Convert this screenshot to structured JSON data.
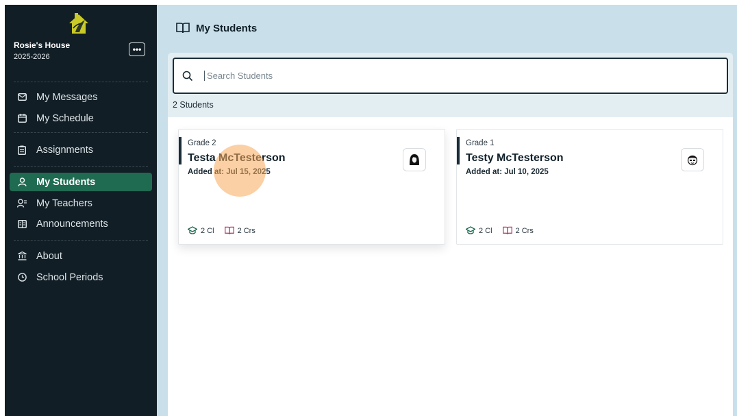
{
  "sidebar": {
    "house_name": "Rosie's House",
    "year": "2025-2026",
    "menu_label": "•••",
    "items": [
      {
        "label": "My Messages",
        "icon": "mail-icon"
      },
      {
        "label": "My Schedule",
        "icon": "calendar-icon"
      },
      {
        "label": "Assignments",
        "icon": "clipboard-icon"
      },
      {
        "label": "My Students",
        "icon": "user-icon",
        "active": true
      },
      {
        "label": "My Teachers",
        "icon": "teacher-icon"
      },
      {
        "label": "Announcements",
        "icon": "megaphone-icon"
      },
      {
        "label": "About",
        "icon": "building-icon"
      },
      {
        "label": "School Periods",
        "icon": "clock-icon"
      }
    ]
  },
  "header": {
    "title": "My Students"
  },
  "search": {
    "placeholder": "Search Students"
  },
  "count_label": "2 Students",
  "students": [
    {
      "grade": "Grade 2",
      "name": "Testa McTesterson",
      "added": "Added at: Jul 15, 2025",
      "classes": "2 Cl",
      "courses": "2 Crs"
    },
    {
      "grade": "Grade 1",
      "name": "Testy McTesterson",
      "added": "Added at: Jul 10, 2025",
      "classes": "2 Cl",
      "courses": "2 Crs"
    }
  ],
  "colors": {
    "sidebar_bg": "#121e25",
    "active_item": "#1f6b52",
    "frame_bg": "#c9dfe9",
    "course_icon": "#b0386a",
    "logo": "#c9c928"
  }
}
